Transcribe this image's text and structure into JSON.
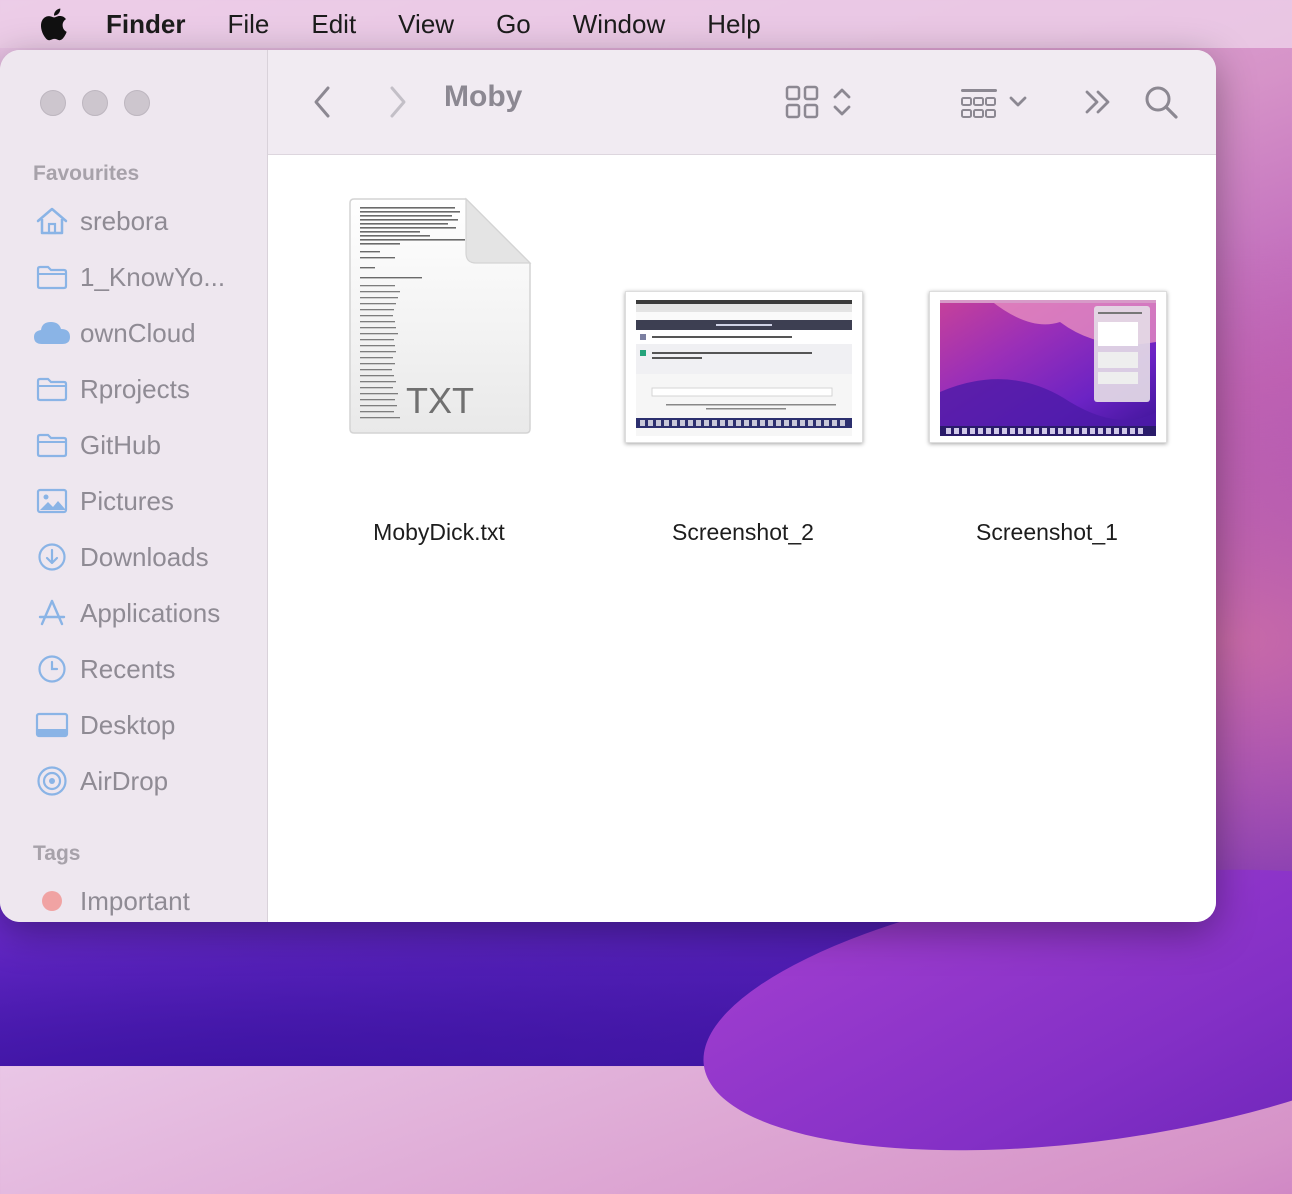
{
  "menubar": {
    "app_name": "Finder",
    "items": [
      "File",
      "Edit",
      "View",
      "Go",
      "Window",
      "Help"
    ]
  },
  "window": {
    "title": "Moby"
  },
  "sidebar": {
    "favourites_label": "Favourites",
    "favourites": [
      {
        "label": "srebora",
        "icon": "home-icon"
      },
      {
        "label": "1_KnowYo...",
        "icon": "folder-icon"
      },
      {
        "label": "ownCloud",
        "icon": "cloud-icon"
      },
      {
        "label": "Rprojects",
        "icon": "folder-icon"
      },
      {
        "label": "GitHub",
        "icon": "folder-icon"
      },
      {
        "label": "Pictures",
        "icon": "pictures-icon"
      },
      {
        "label": "Downloads",
        "icon": "downloads-icon"
      },
      {
        "label": "Applications",
        "icon": "applications-icon"
      },
      {
        "label": "Recents",
        "icon": "recents-icon"
      },
      {
        "label": "Desktop",
        "icon": "desktop-icon"
      },
      {
        "label": "AirDrop",
        "icon": "airdrop-icon"
      }
    ],
    "tags_label": "Tags",
    "tags": [
      {
        "label": "Important",
        "color": "#f0a3a3"
      }
    ]
  },
  "files": [
    {
      "name": "MobyDick.txt",
      "type": "txt",
      "badge": "TXT"
    },
    {
      "name": "Screenshot_2",
      "type": "image"
    },
    {
      "name": "Screenshot_1",
      "type": "image"
    }
  ],
  "colors": {
    "sidebar_icon": "#8ab4e6",
    "sidebar_text": "#8f8b94",
    "tag_important": "#f0a3a3"
  }
}
